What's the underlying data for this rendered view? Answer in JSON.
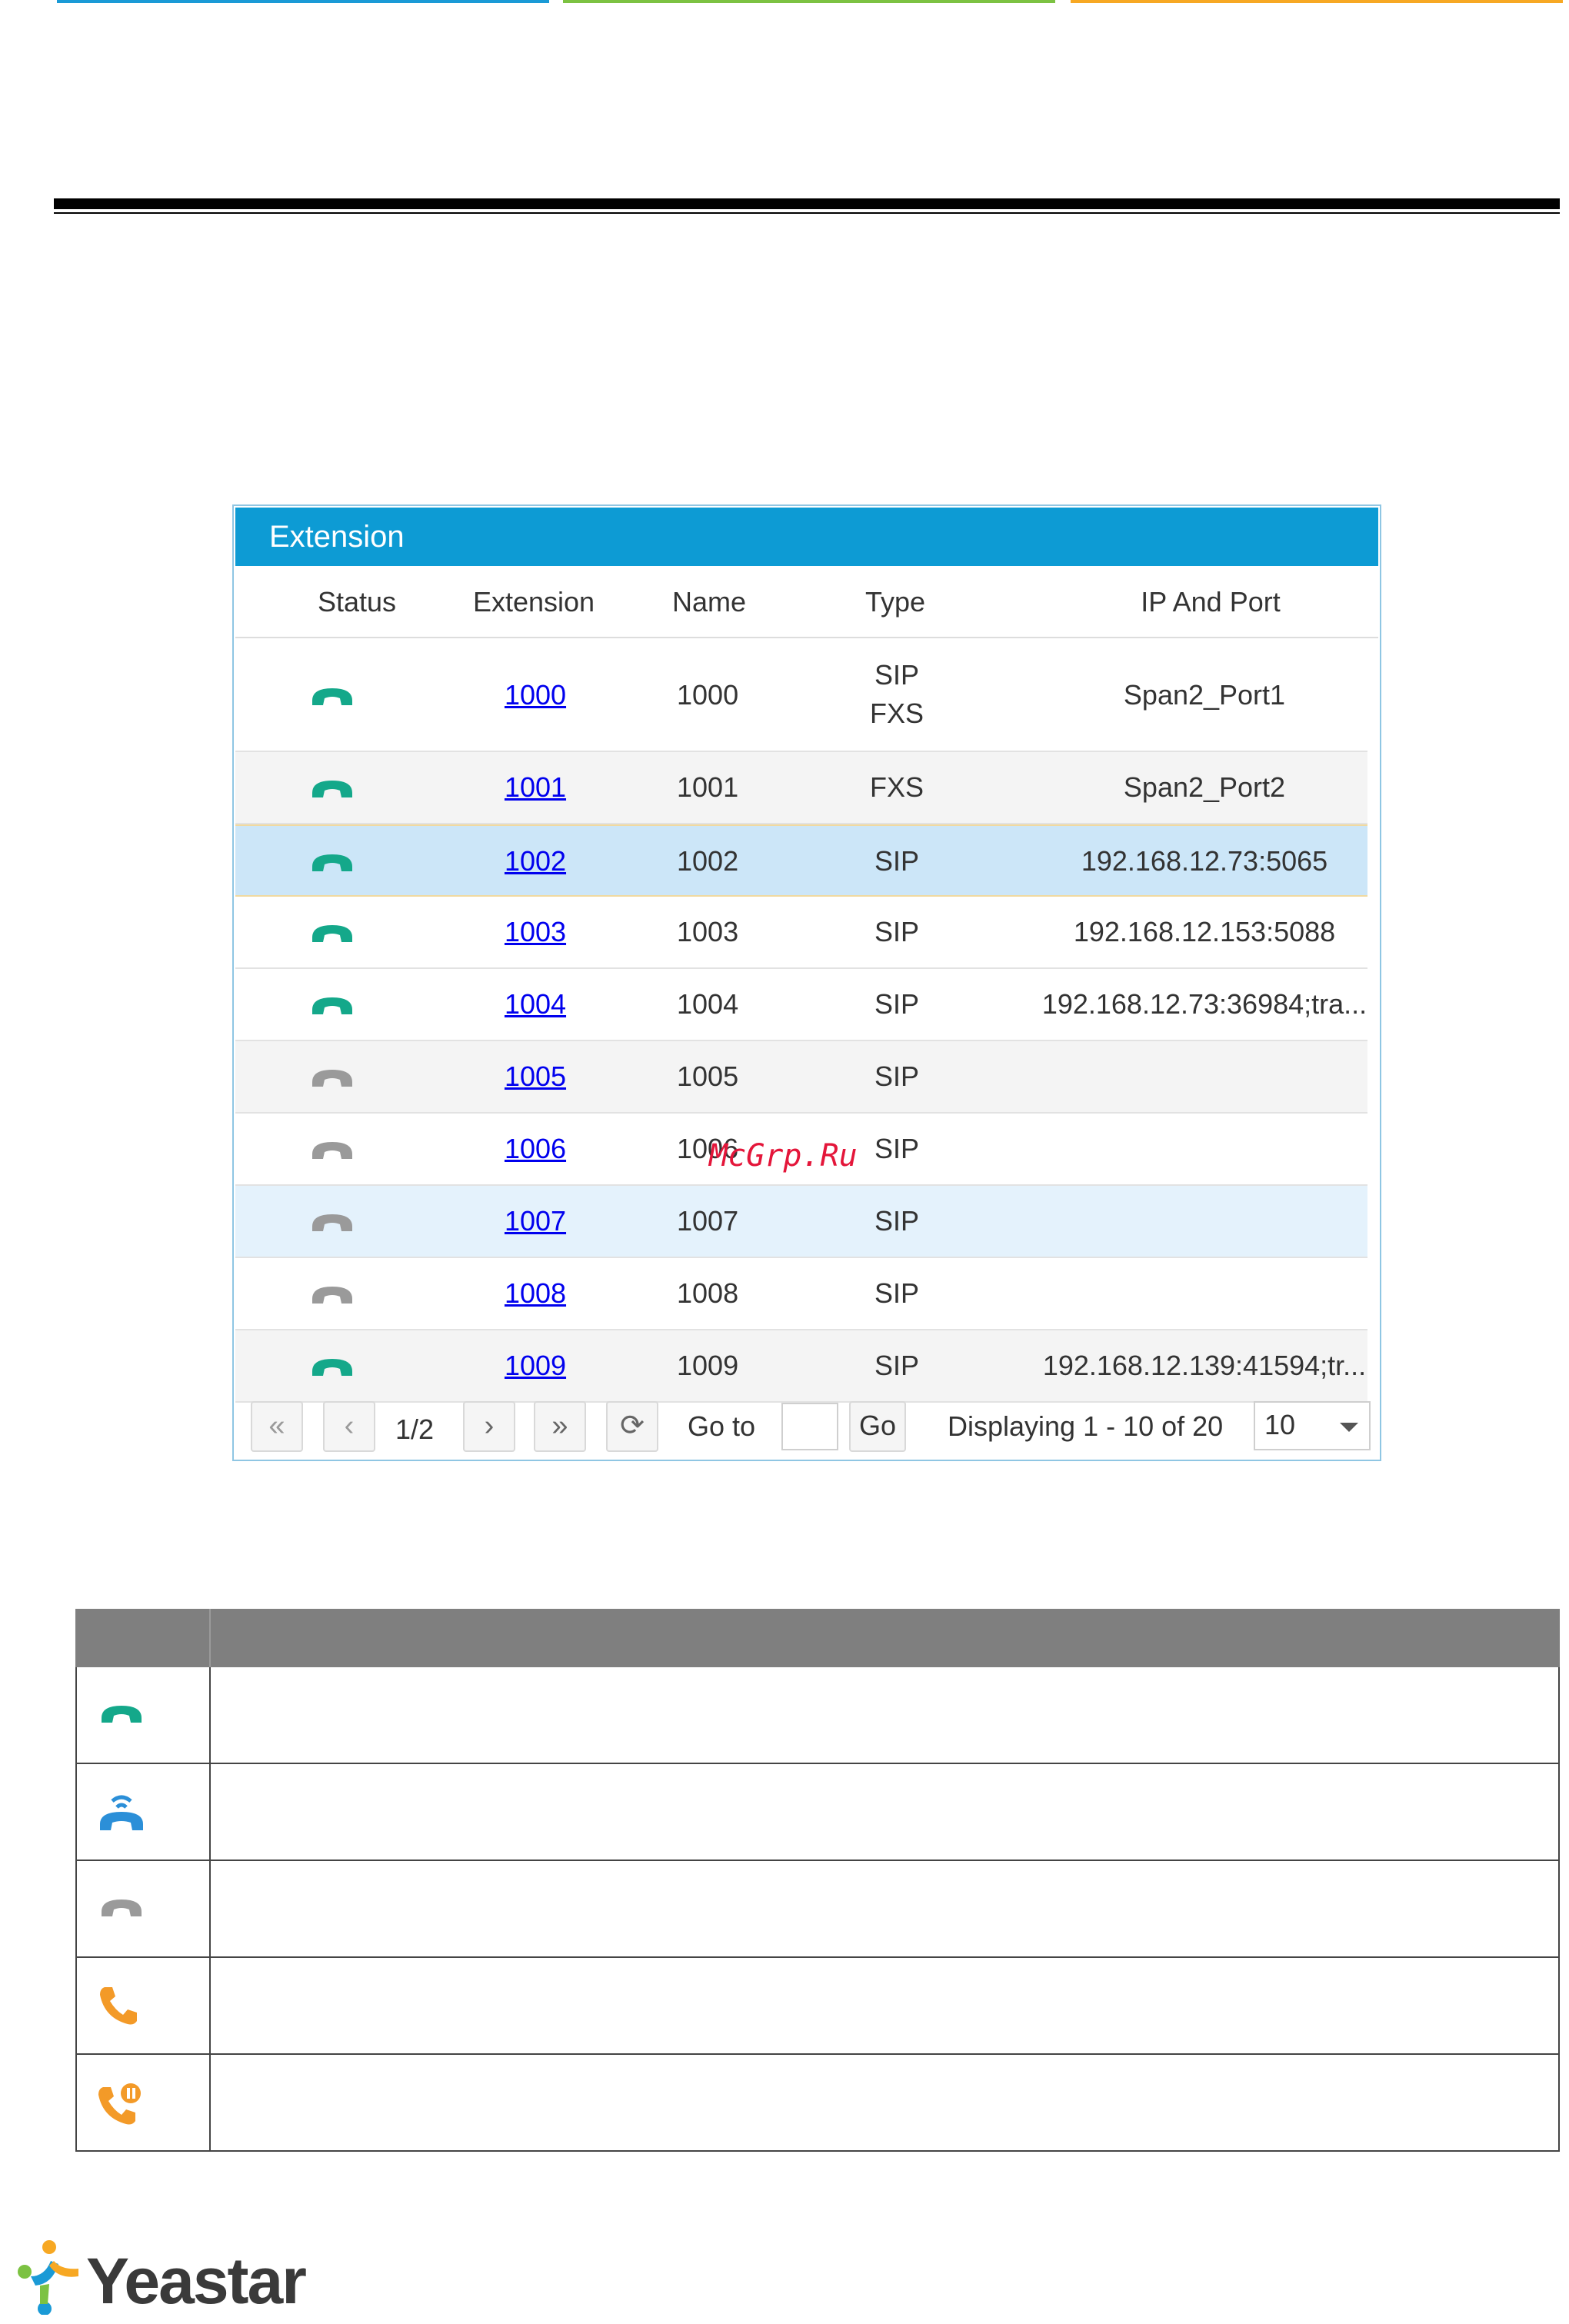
{
  "panel": {
    "title": "Extension",
    "columns": [
      "Status",
      "Extension",
      "Name",
      "Type",
      "IP And Port"
    ],
    "rows": [
      {
        "status": "registered",
        "extension": "1000",
        "name": "1000",
        "type_line1": "SIP",
        "type_line2": "FXS",
        "ip": "Span2_Port1"
      },
      {
        "status": "registered",
        "extension": "1001",
        "name": "1001",
        "type_line1": "FXS",
        "type_line2": "",
        "ip": "Span2_Port2"
      },
      {
        "status": "registered",
        "extension": "1002",
        "name": "1002",
        "type_line1": "SIP",
        "type_line2": "",
        "ip": "192.168.12.73:5065"
      },
      {
        "status": "registered",
        "extension": "1003",
        "name": "1003",
        "type_line1": "SIP",
        "type_line2": "",
        "ip": "192.168.12.153:5088"
      },
      {
        "status": "registered",
        "extension": "1004",
        "name": "1004",
        "type_line1": "SIP",
        "type_line2": "",
        "ip": "192.168.12.73:36984;tra..."
      },
      {
        "status": "unavailable",
        "extension": "1005",
        "name": "1005",
        "type_line1": "SIP",
        "type_line2": "",
        "ip": ""
      },
      {
        "status": "unavailable",
        "extension": "1006",
        "name": "1006",
        "type_line1": "SIP",
        "type_line2": "",
        "ip": ""
      },
      {
        "status": "unavailable",
        "extension": "1007",
        "name": "1007",
        "type_line1": "SIP",
        "type_line2": "",
        "ip": ""
      },
      {
        "status": "unavailable",
        "extension": "1008",
        "name": "1008",
        "type_line1": "SIP",
        "type_line2": "",
        "ip": ""
      },
      {
        "status": "registered",
        "extension": "1009",
        "name": "1009",
        "type_line1": "SIP",
        "type_line2": "",
        "ip": "192.168.12.139:41594;tr..."
      }
    ],
    "pager": {
      "page": "1/2",
      "goto_label": "Go to",
      "goto_value": "",
      "go_button": "Go",
      "displaying": "Displaying 1 - 10 of 20",
      "page_size": "10"
    }
  },
  "watermark": "McGrp.Ru",
  "legend_icons": [
    "phone-green-icon",
    "phone-ringing-blue-icon",
    "phone-gray-icon",
    "phone-orange-icon",
    "phone-hold-orange-icon"
  ],
  "logo": {
    "text": "Yeastar"
  },
  "colors": {
    "header_blue": "#0d9bd4",
    "registered_green": "#14a88a",
    "unavailable_gray": "#9a9a9a",
    "ringing_blue": "#2b8fd8",
    "busy_orange": "#f39a28",
    "top_bar_blue": "#1a9ad6",
    "top_bar_green": "#7cc242",
    "top_bar_orange": "#f7a823"
  }
}
